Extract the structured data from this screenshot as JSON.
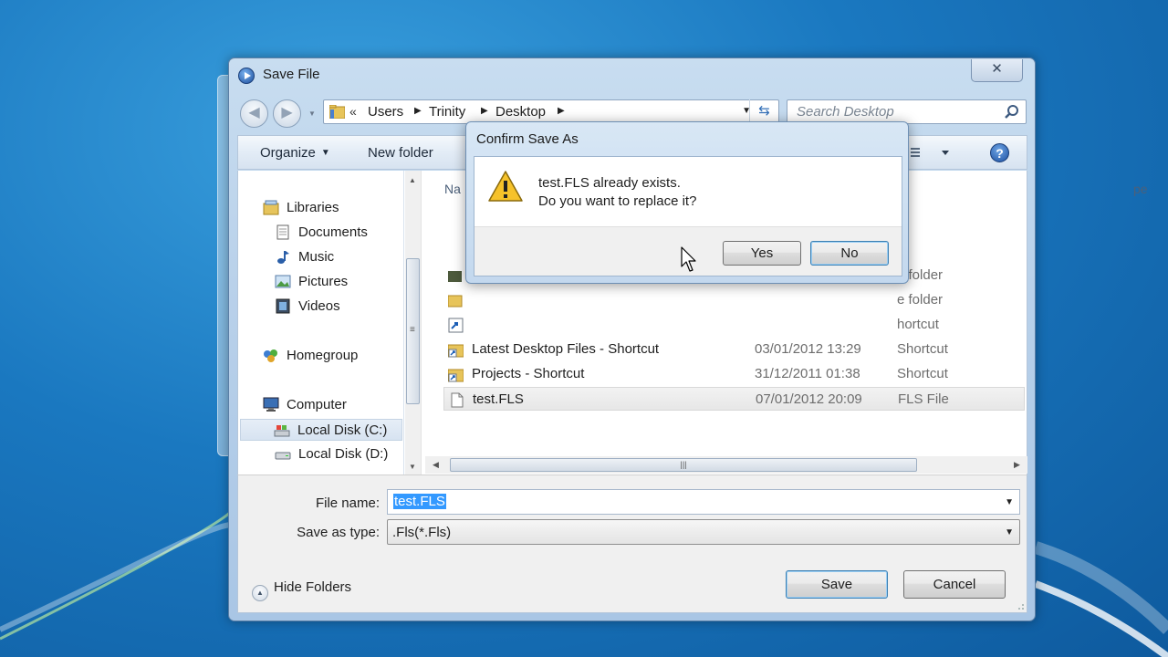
{
  "dialog": {
    "title": "Save File",
    "close_label": "✕",
    "address": {
      "crumbs": [
        "Users",
        "Trinity",
        "Desktop"
      ],
      "chevron": "«"
    },
    "search": {
      "placeholder": "Search Desktop"
    },
    "toolbar": {
      "organize": "Organize",
      "new_folder": "New folder",
      "help": "?"
    },
    "nav_pane": {
      "items": [
        {
          "label": "Libraries",
          "icon": "libraries-icon"
        },
        {
          "label": "Documents",
          "icon": "documents-icon"
        },
        {
          "label": "Music",
          "icon": "music-icon"
        },
        {
          "label": "Pictures",
          "icon": "pictures-icon"
        },
        {
          "label": "Videos",
          "icon": "videos-icon"
        },
        {
          "label": "Homegroup",
          "icon": "homegroup-icon"
        },
        {
          "label": "Computer",
          "icon": "computer-icon"
        },
        {
          "label": "Local Disk (C:)",
          "icon": "local-disk-c-icon",
          "selected": true
        },
        {
          "label": "Local Disk (D:)",
          "icon": "local-disk-d-icon"
        }
      ]
    },
    "file_list": {
      "columns": {
        "name": "Na",
        "type": "pe"
      },
      "rows": [
        {
          "name": "",
          "date": "",
          "type": "e folder"
        },
        {
          "name": "",
          "date": "",
          "type": "e folder"
        },
        {
          "name": "",
          "date": "",
          "type": "hortcut"
        },
        {
          "name": "Latest Desktop Files - Shortcut",
          "date": "03/01/2012 13:29",
          "type": "Shortcut"
        },
        {
          "name": "Projects - Shortcut",
          "date": "31/12/2011 01:38",
          "type": "Shortcut"
        },
        {
          "name": "test.FLS",
          "date": "07/01/2012 20:09",
          "type": "FLS File",
          "selected": true
        }
      ]
    },
    "file_name": {
      "label": "File name:",
      "value": "test.FLS"
    },
    "save_as_type": {
      "label": "Save as type:",
      "value": ".Fls(*.Fls)"
    },
    "hide_folders": "Hide Folders",
    "save_button": "Save",
    "cancel_button": "Cancel"
  },
  "confirm": {
    "title": "Confirm Save As",
    "line1": "test.FLS already exists.",
    "line2": "Do you want to replace it?",
    "yes": "Yes",
    "no": "No"
  },
  "colors": {
    "desktop": "#1a78c0",
    "selection": "#3399ff",
    "dialog_frame": "#b9d1ea"
  }
}
